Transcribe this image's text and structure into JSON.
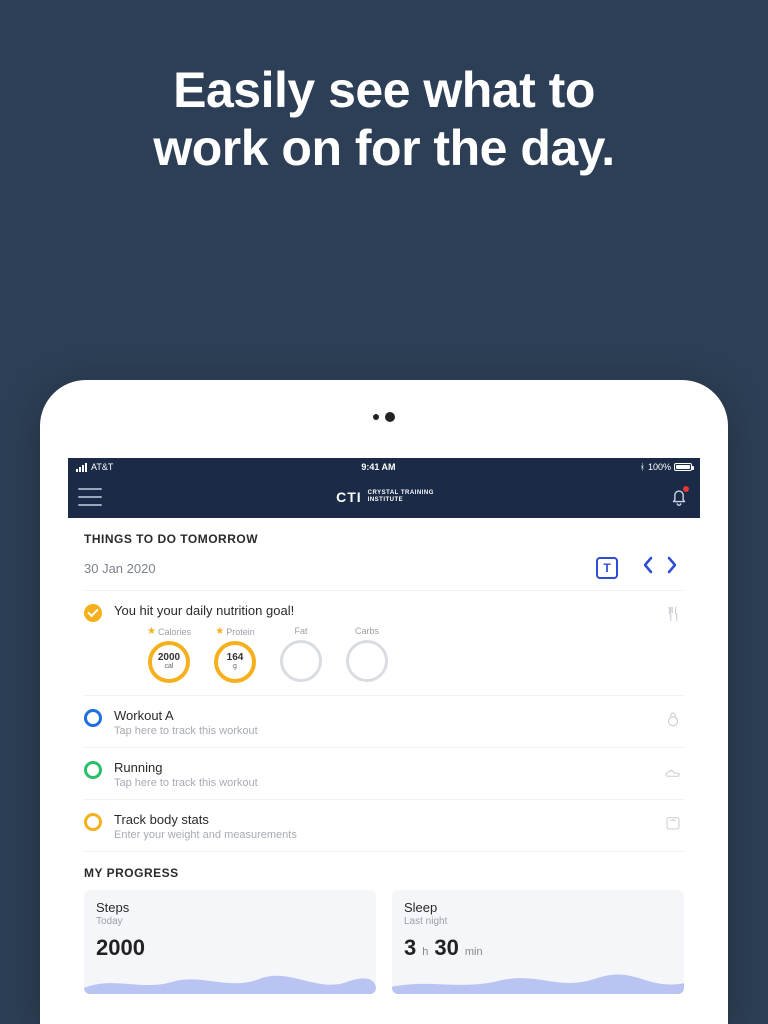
{
  "hero": {
    "line1": "Easily see what to",
    "line2": "work on for the day."
  },
  "status": {
    "carrier": "AT&T",
    "time": "9:41 AM",
    "battery": "100%"
  },
  "header": {
    "logo_main": "CTI",
    "logo_sub1": "CRYSTAL TRAINING",
    "logo_sub2": "INSTITUTE"
  },
  "todo_header": {
    "title": "THINGS TO DO TOMORROW",
    "date": "30 Jan 2020",
    "today_btn": "T"
  },
  "nutrition": {
    "title": "You hit your daily nutrition goal!",
    "cols": {
      "calories": {
        "label": "Calories",
        "value": "2000",
        "unit": "cal"
      },
      "protein": {
        "label": "Protein",
        "value": "164",
        "unit": "g"
      },
      "fat": {
        "label": "Fat"
      },
      "carbs": {
        "label": "Carbs"
      }
    }
  },
  "tasks": {
    "workout": {
      "title": "Workout A",
      "sub": "Tap here to track this workout"
    },
    "running": {
      "title": "Running",
      "sub": "Tap here to track this workout"
    },
    "body": {
      "title": "Track body stats",
      "sub": "Enter your weight and measurements"
    }
  },
  "progress": {
    "title": "MY PROGRESS",
    "steps": {
      "name": "Steps",
      "when": "Today",
      "value": "2000"
    },
    "sleep": {
      "name": "Sleep",
      "when": "Last night",
      "h": "3",
      "hu": "h",
      "m": "30",
      "mu": "min"
    }
  }
}
